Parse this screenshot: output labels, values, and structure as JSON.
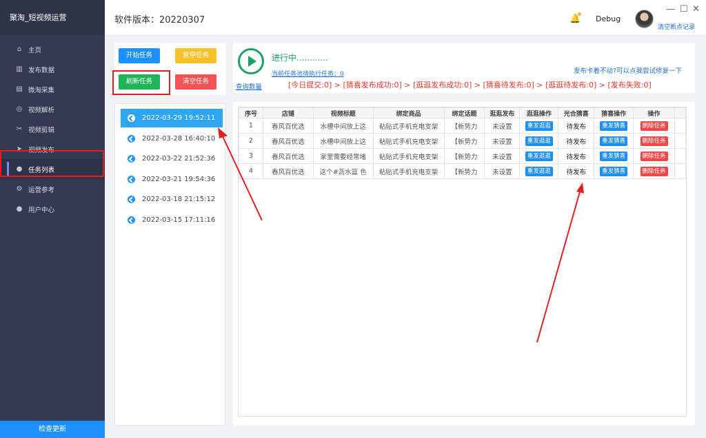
{
  "app": {
    "title": "聚淘_短视频运营",
    "version_label": "软件版本：20220307",
    "user": "Debug",
    "clear_breakpoints": "清空断点记录"
  },
  "window_controls": {
    "minimize": "—",
    "maximize": "☐",
    "close": "✕"
  },
  "sidebar": {
    "items": [
      {
        "label": "主页",
        "icon": "home-icon",
        "glyph": "⌂"
      },
      {
        "label": "发布数据",
        "icon": "bar-chart-icon",
        "glyph": "▥"
      },
      {
        "label": "微淘采集",
        "icon": "document-icon",
        "glyph": "▤"
      },
      {
        "label": "视频解析",
        "icon": "circle-icon",
        "glyph": "◎"
      },
      {
        "label": "视频剪辑",
        "icon": "scissors-icon",
        "glyph": "✂"
      },
      {
        "label": "视频发布",
        "icon": "send-icon",
        "glyph": "➤"
      },
      {
        "label": "任务列表",
        "icon": "user-icon",
        "glyph": "●"
      },
      {
        "label": "运营参考",
        "icon": "gear-icon",
        "glyph": "⚙"
      },
      {
        "label": "用户中心",
        "icon": "user-icon",
        "glyph": "●"
      }
    ],
    "active_index": 6,
    "footer": "检查更新"
  },
  "controls": {
    "start": "开始任务",
    "pause": "暂停任务",
    "refresh": "刷新任务",
    "clear": "清空任务"
  },
  "tasks": [
    "2022-03-29 19:52:11",
    "2022-03-28 16:40:10",
    "2022-03-22 21:52:36",
    "2022-03-21 19:54:36",
    "2022-03-18 21:15:12",
    "2022-03-15 17:11:16"
  ],
  "status": {
    "running": "进行中............",
    "pending": "当前任务池待执行任务：0",
    "help": "发布卡着不动?可以点我尝试修复一下",
    "query": "查询数量",
    "stats": "[今日提交:0] > [猜喜发布成功:0] > [逛逛发布成功:0] > [猜喜待发布:0] > [逛逛待发布:0] > [发布失败:0]"
  },
  "table": {
    "headers": [
      "序号",
      "店铺",
      "视频标题",
      "绑定商品",
      "绑定话题",
      "逛逛发布",
      "逛逛操作",
      "光合猜喜",
      "猜喜操作",
      "操作"
    ],
    "rows": [
      {
        "no": "1",
        "shop": "春风百优选",
        "title": "水槽中间放上这",
        "product": "粘贴式手机充电支架",
        "topic": "【新势力",
        "gg": "未设置",
        "gg_op": "重发逛逛",
        "cx": "待发布",
        "cx_op": "重发猜喜",
        "op": "删除任务"
      },
      {
        "no": "2",
        "shop": "春风百优选",
        "title": "水槽中间放上这",
        "product": "粘贴式手机充电支架",
        "topic": "【新势力",
        "gg": "未设置",
        "gg_op": "重发逛逛",
        "cx": "待发布",
        "cx_op": "重发猜喜",
        "op": "删除任务"
      },
      {
        "no": "3",
        "shop": "春风百优选",
        "title": "家里需要经常堵",
        "product": "粘贴式手机充电支架",
        "topic": "【新势力",
        "gg": "未设置",
        "gg_op": "重发逛逛",
        "cx": "待发布",
        "cx_op": "重发猜喜",
        "op": "删除任务"
      },
      {
        "no": "4",
        "shop": "春风百优选",
        "title": "这个#沥水篮 色",
        "product": "粘贴式手机充电支架",
        "topic": "【新势力",
        "gg": "未设置",
        "gg_op": "重发逛逛",
        "cx": "待发布",
        "cx_op": "重发猜喜",
        "op": "删除任务"
      }
    ]
  },
  "colors": {
    "sidebar": "#363952",
    "accent": "#1e90ff",
    "success": "#1aa060",
    "danger": "#f05454",
    "annotation": "#e02020"
  }
}
